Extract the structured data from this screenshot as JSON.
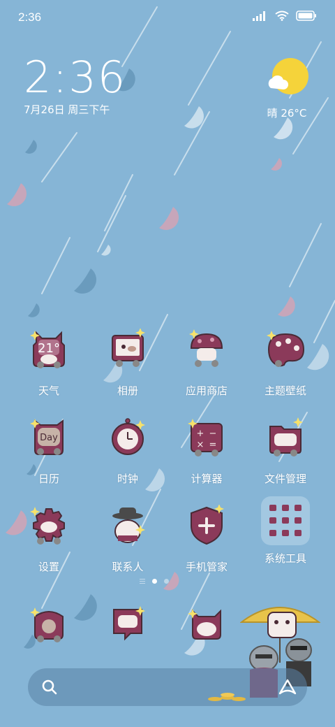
{
  "status_bar": {
    "time": "2:36"
  },
  "clock": {
    "time": "2:36",
    "date": "7月26日 周三下午"
  },
  "weather": {
    "text": "晴 26°C",
    "icon_temp": "21°"
  },
  "apps": [
    {
      "label": "天气",
      "icon": "weather-icon"
    },
    {
      "label": "相册",
      "icon": "gallery-icon"
    },
    {
      "label": "应用商店",
      "icon": "app-store-icon"
    },
    {
      "label": "主题壁纸",
      "icon": "themes-icon"
    },
    {
      "label": "日历",
      "icon": "calendar-icon",
      "icon_text": "Day"
    },
    {
      "label": "时钟",
      "icon": "clock-icon"
    },
    {
      "label": "计算器",
      "icon": "calculator-icon"
    },
    {
      "label": "文件管理",
      "icon": "file-manager-icon"
    },
    {
      "label": "设置",
      "icon": "settings-icon"
    },
    {
      "label": "联系人",
      "icon": "contacts-icon"
    },
    {
      "label": "手机管家",
      "icon": "security-icon"
    },
    {
      "label": "系统工具",
      "icon": "folder-icon"
    }
  ],
  "dock": [
    {
      "name": "phone",
      "icon": "phone-icon"
    },
    {
      "name": "messages",
      "icon": "messages-icon"
    },
    {
      "name": "browser",
      "icon": "browser-icon"
    },
    {
      "name": "camera",
      "icon": "camera-icon"
    }
  ],
  "page_indicator": {
    "pages": 2,
    "current": 1
  },
  "colors": {
    "background": "#86b5d6",
    "icon_primary": "#8b3a5a",
    "sun": "#f5d33a"
  }
}
